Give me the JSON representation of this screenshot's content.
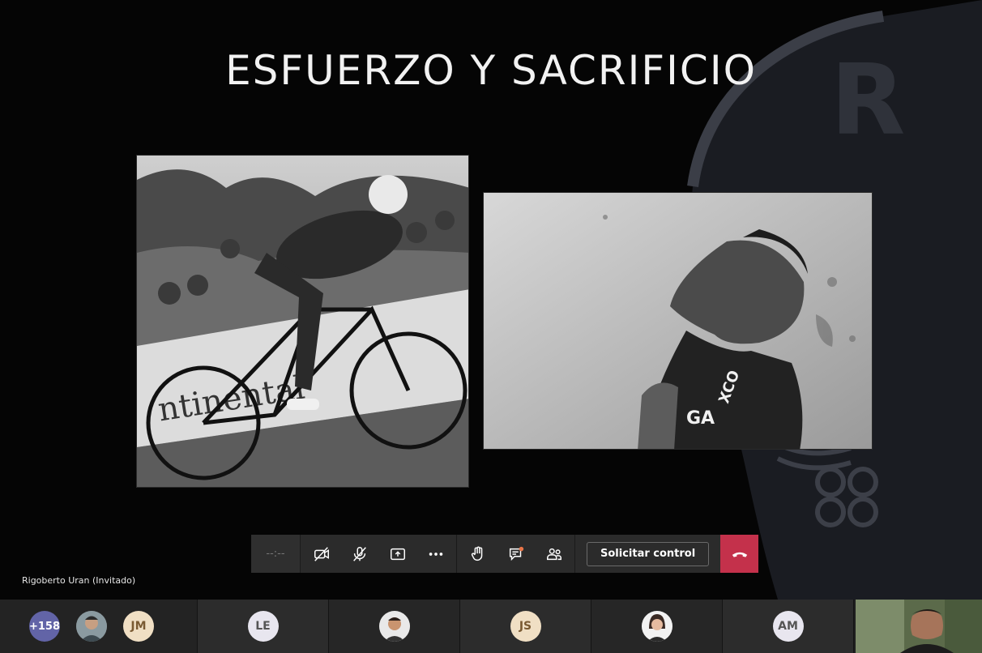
{
  "slide": {
    "title": "ESFUERZO Y SACRIFICIO",
    "images": [
      {
        "name": "cyclist-climbing-photo",
        "description_icon": "cyclist-photo"
      },
      {
        "name": "exhausted-rider-photo",
        "description_icon": "rider-portrait-photo"
      }
    ]
  },
  "toolbar": {
    "timer": "--:--",
    "buttons": [
      {
        "name": "camera-off-button",
        "icon": "camera-off-icon"
      },
      {
        "name": "mic-off-button",
        "icon": "mic-off-icon"
      },
      {
        "name": "share-screen-button",
        "icon": "share-tray-icon"
      },
      {
        "name": "more-options-button",
        "icon": "ellipsis-icon"
      },
      {
        "name": "raise-hand-button",
        "icon": "hand-icon"
      },
      {
        "name": "chat-button",
        "icon": "chat-icon"
      },
      {
        "name": "participants-button",
        "icon": "people-icon"
      }
    ],
    "request_control_label": "Solicitar control",
    "hangup_icon": "phone-hangup-icon",
    "hangup_color": "#c4314b"
  },
  "presenter": {
    "name": "Rigoberto Uran (Invitado)"
  },
  "participants": {
    "overflow_count": "+158",
    "initials": [
      "JM",
      "LE",
      "JS",
      "AM"
    ]
  },
  "colors": {
    "accent": "#6264a7",
    "toolbar": "#2b2b2b",
    "strip": "#1f1f1f"
  }
}
